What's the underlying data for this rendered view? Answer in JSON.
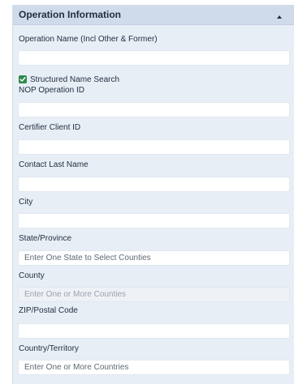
{
  "panel": {
    "title": "Operation Information",
    "collapse_icon": "caret-up-icon"
  },
  "fields": {
    "operation_name": {
      "label": "Operation Name (Incl Other & Former)",
      "value": "",
      "placeholder": ""
    },
    "structured_search": {
      "label": "Structured Name Search",
      "checked": true
    },
    "nop_id": {
      "label": "NOP Operation ID",
      "value": "",
      "placeholder": ""
    },
    "certifier_client_id": {
      "label": "Certifier Client ID",
      "value": "",
      "placeholder": ""
    },
    "contact_last_name": {
      "label": "Contact Last Name",
      "value": "",
      "placeholder": ""
    },
    "city": {
      "label": "City",
      "value": "",
      "placeholder": ""
    },
    "state": {
      "label": "State/Province",
      "value": "",
      "placeholder": "Enter One State to Select Counties"
    },
    "county": {
      "label": "County",
      "value": "",
      "placeholder": "Enter One or More Counties"
    },
    "zip": {
      "label": "ZIP/Postal Code",
      "value": "",
      "placeholder": ""
    },
    "country": {
      "label": "Country/Territory",
      "value": "",
      "placeholder": "Enter One or More Countries"
    }
  },
  "colors": {
    "panel_bg": "#e8eef6",
    "header_bg": "#cfdbea",
    "checkbox": "#2e8a4a"
  }
}
